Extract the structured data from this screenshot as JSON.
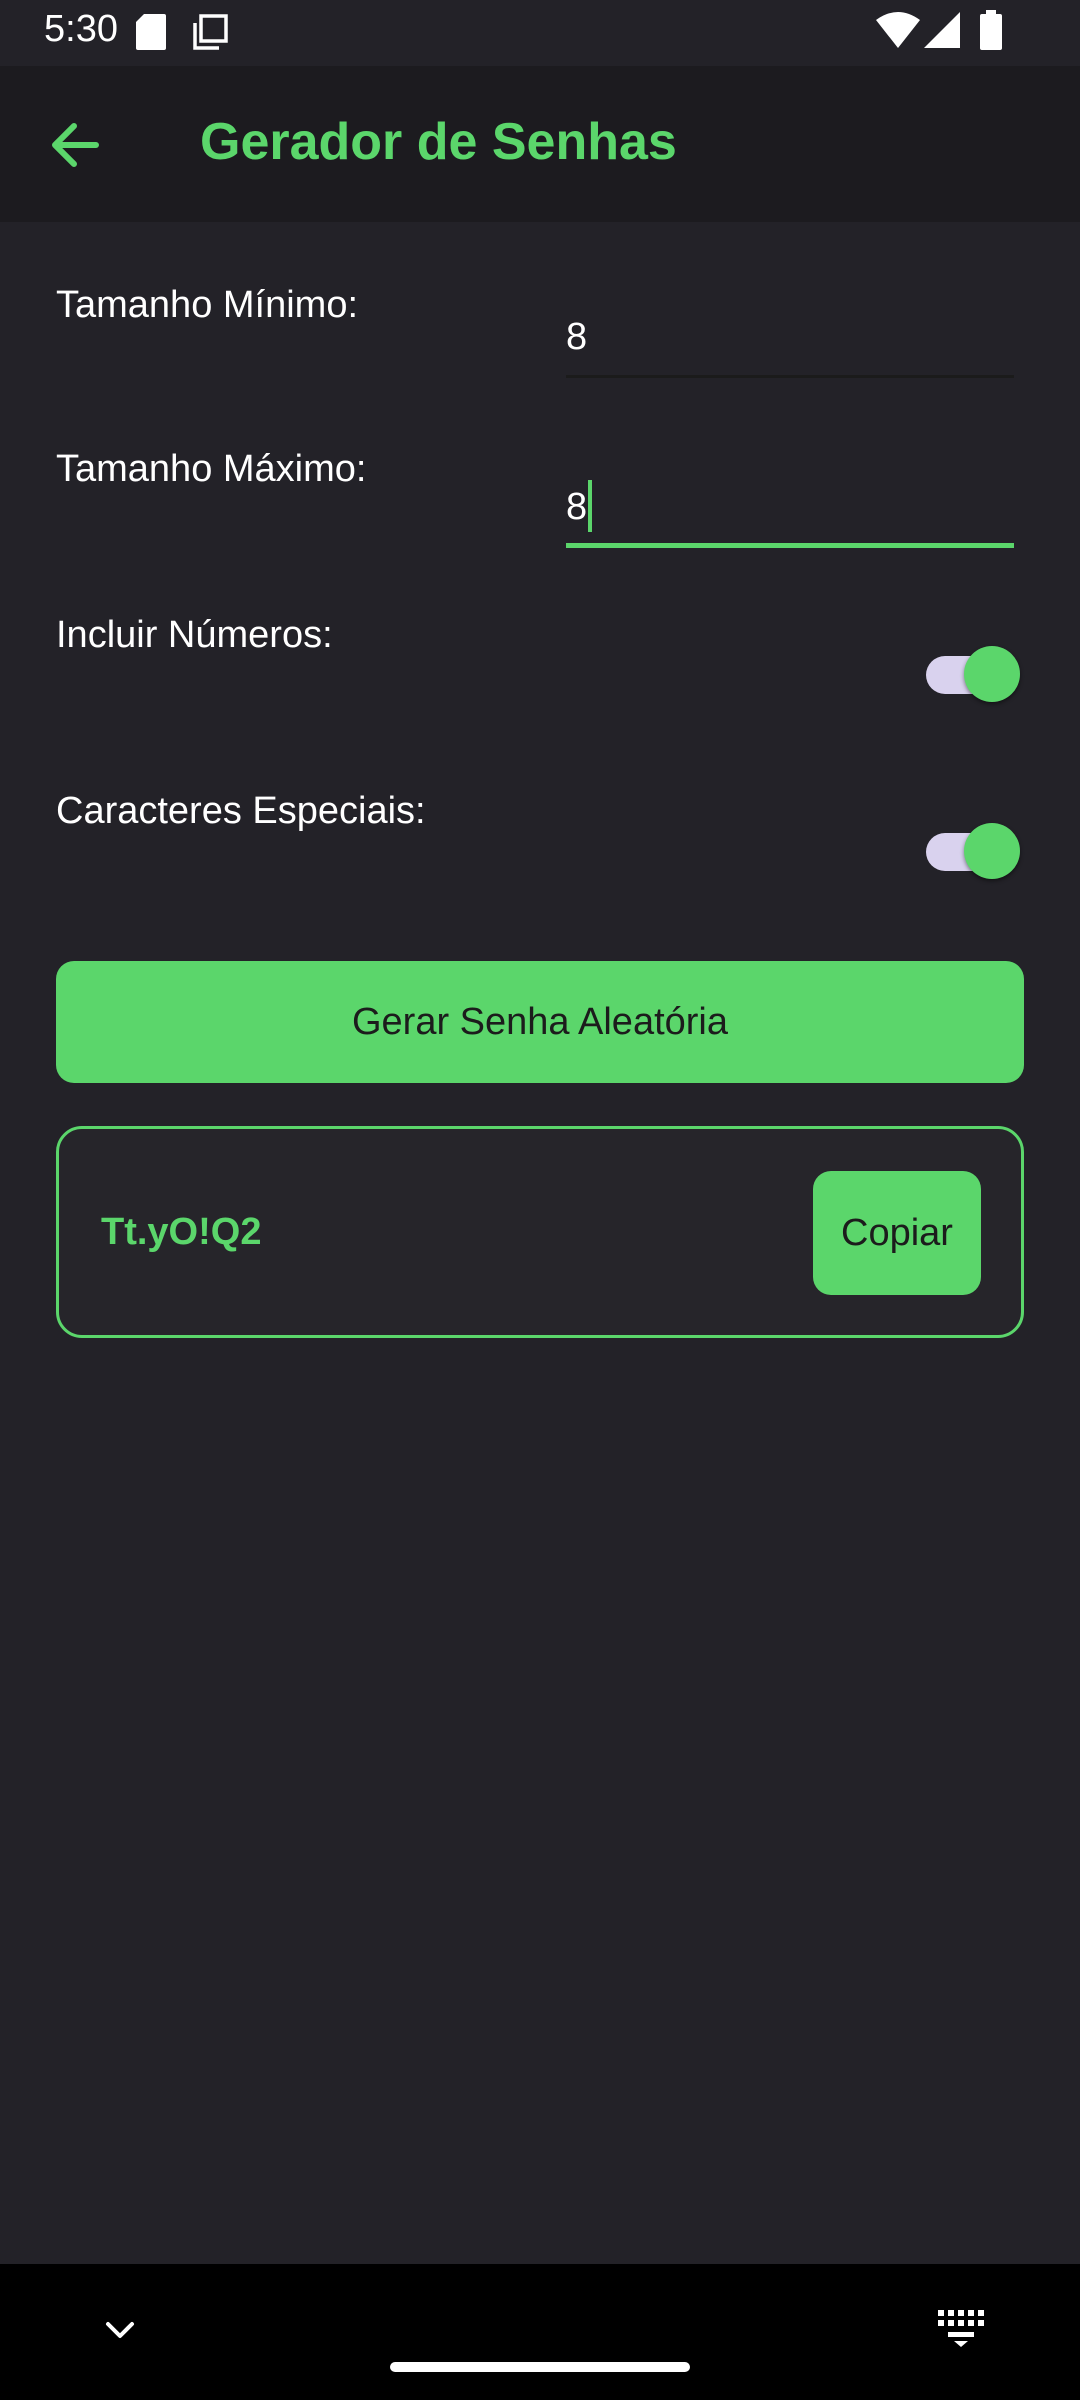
{
  "status_bar": {
    "time": "5:30",
    "icons": [
      "sd-card-icon",
      "copy-icon",
      "wifi-icon",
      "signal-icon",
      "battery-icon"
    ]
  },
  "app_bar": {
    "title": "Gerador de Senhas",
    "back_icon": "arrow-back-icon"
  },
  "form": {
    "min_length": {
      "label": "Tamanho Mínimo:",
      "value": "8"
    },
    "max_length": {
      "label": "Tamanho Máximo:",
      "value": "8"
    },
    "include_numbers": {
      "label": "Incluir Números:",
      "checked": true
    },
    "special_chars": {
      "label": "Caracteres Especiais:",
      "checked": true
    }
  },
  "generate_button": {
    "label": "Gerar Senha Aleatória"
  },
  "result": {
    "password": "Tt.yO!Q2",
    "copy_label": "Copiar"
  },
  "nav_bar": {
    "icons": [
      "chevron-down-icon",
      "keyboard-icon"
    ]
  },
  "colors": {
    "accent": "#5bd66b",
    "background": "#232228",
    "app_bar": "#1c1b1f",
    "switch_track": "#d9d2ee",
    "nav_bar": "#000000"
  }
}
